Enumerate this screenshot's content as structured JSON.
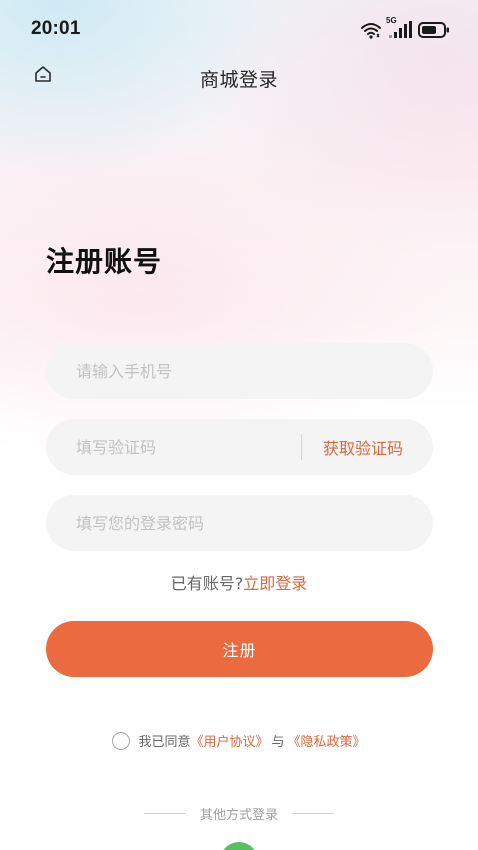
{
  "status_bar": {
    "time": "20:01",
    "network": "5G",
    "icons": [
      "wifi-icon",
      "signal-icon",
      "battery-icon"
    ]
  },
  "nav": {
    "title": "商城登录",
    "home_icon": "home-icon"
  },
  "page": {
    "heading": "注册账号"
  },
  "form": {
    "phone_placeholder": "请输入手机号",
    "phone_value": "",
    "code_placeholder": "填写验证码",
    "code_value": "",
    "get_code_label": "获取验证码",
    "password_placeholder": "填写您的登录密码",
    "password_value": "",
    "have_account_text": "已有账号?",
    "login_now_label": "立即登录",
    "register_label": "注册"
  },
  "agreement": {
    "prefix": "我已同意",
    "user_agreement": "《用户协议》",
    "connector": "与",
    "privacy_policy": "《隐私政策》",
    "checked": false
  },
  "other_login": {
    "label": "其他方式登录",
    "methods": [
      "wechat-icon"
    ]
  },
  "colors": {
    "accent": "#ec6a3f",
    "link": "#e0663c",
    "input_bg": "#f4f4f4",
    "wechat": "#58bf62"
  }
}
